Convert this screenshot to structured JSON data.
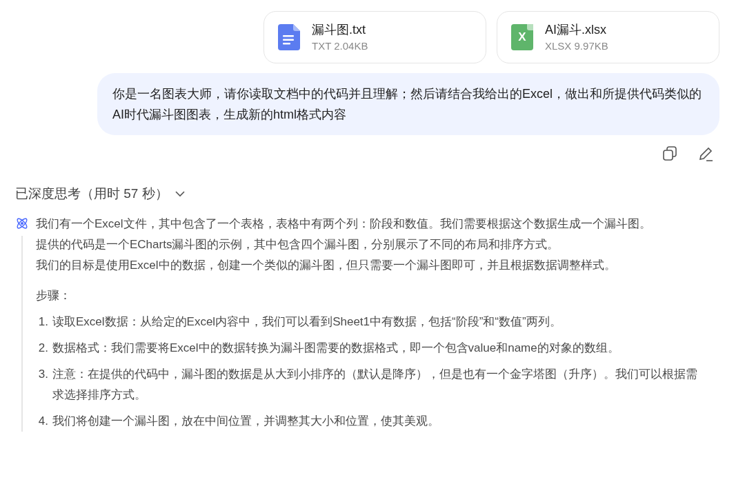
{
  "attachments": [
    {
      "kind": "txt",
      "name": "漏斗图.txt",
      "meta": "TXT 2.04KB"
    },
    {
      "kind": "xlsx",
      "icon_label": "X",
      "name": "AI漏斗.xlsx",
      "meta": "XLSX 9.97KB"
    }
  ],
  "user_message": "你是一名图表大师，请你读取文档中的代码并且理解；然后请结合我给出的Excel，做出和所提供代码类似的AI时代漏斗图图表，生成新的html格式内容",
  "thinking": {
    "title": "已深度思考（用时 57 秒）",
    "expanded": true,
    "paragraphs": [
      "我们有一个Excel文件，其中包含了一个表格，表格中有两个列：阶段和数值。我们需要根据这个数据生成一个漏斗图。",
      "提供的代码是一个ECharts漏斗图的示例，其中包含四个漏斗图，分别展示了不同的布局和排序方式。",
      "我们的目标是使用Excel中的数据，创建一个类似的漏斗图，但只需要一个漏斗图即可，并且根据数据调整样式。"
    ],
    "steps_title": "步骤：",
    "steps": [
      {
        "number": "1.",
        "text": "读取Excel数据：从给定的Excel内容中，我们可以看到Sheet1中有数据，包括“阶段”和“数值”两列。"
      },
      {
        "number": "2.",
        "text": "数据格式：我们需要将Excel中的数据转换为漏斗图需要的数据格式，即一个包含value和name的对象的数组。"
      },
      {
        "number": "3.",
        "text": "注意：在提供的代码中，漏斗图的数据是从大到小排序的（默认是降序），但是也有一个金字塔图（升序）。我们可以根据需求选择排序方式。"
      },
      {
        "number": "4.",
        "text": "我们将创建一个漏斗图，放在中间位置，并调整其大小和位置，使其美观。"
      }
    ]
  }
}
